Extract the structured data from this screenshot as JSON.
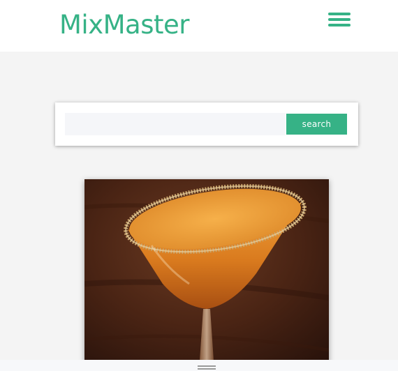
{
  "header": {
    "logo_text": "MixMaster",
    "menu_icon": "hamburger-menu-icon"
  },
  "search": {
    "input_value": "",
    "placeholder": "",
    "button_label": "search"
  },
  "featured_drink": {
    "image_subject": "cocktail-in-martini-glass-with-sugar-rim"
  },
  "bottom_bar": {
    "handle_icon": "drag-handle-icon"
  },
  "colors": {
    "accent": "#36b286",
    "page_background": "#f4f4f4",
    "header_background": "#ffffff",
    "input_background": "#f5f6f9"
  }
}
